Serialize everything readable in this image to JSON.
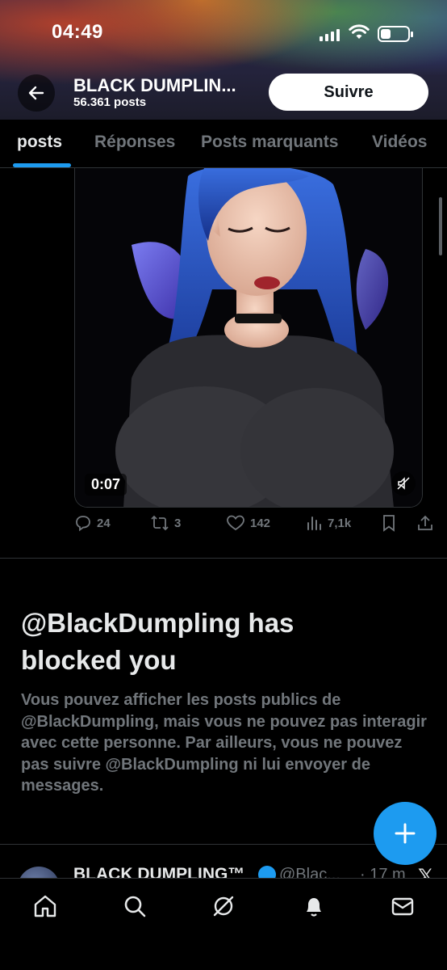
{
  "status_bar": {
    "time": "04:49"
  },
  "header": {
    "profile_name": "BLACK DUMPLIN...",
    "post_count": "56.361 posts",
    "follow_label": "Suivre"
  },
  "tabs": [
    {
      "label": "posts",
      "active": true
    },
    {
      "label": "Réponses",
      "active": false
    },
    {
      "label": "Posts marquants",
      "active": false
    },
    {
      "label": "Vidéos",
      "active": false
    }
  ],
  "post": {
    "video_duration": "0:07",
    "replies": "24",
    "reposts": "3",
    "likes": "142",
    "views": "7,1k"
  },
  "blocked": {
    "title": "@BlackDumpling has blocked you",
    "body": "Vous pouvez afficher les posts publics de @BlackDumpling, mais vous ne pouvez pas interagir avec cette personne. Par ailleurs, vous ne pouvez pas suivre @BlackDumpling ni lui envoyer de messages."
  },
  "next_post": {
    "name": "BLACK DUMPLING™",
    "handle": "@Blac...",
    "time": "· 17 m"
  },
  "colors": {
    "accent": "#1d9bf0",
    "muted_text": "#71767b",
    "background": "#000000"
  },
  "icons": [
    "back-arrow-icon",
    "home-icon",
    "search-icon",
    "grok-icon",
    "bell-icon",
    "mail-icon",
    "plus-icon",
    "mute-icon",
    "reply-icon",
    "repost-icon",
    "like-icon",
    "views-icon",
    "bookmark-icon",
    "share-icon"
  ]
}
